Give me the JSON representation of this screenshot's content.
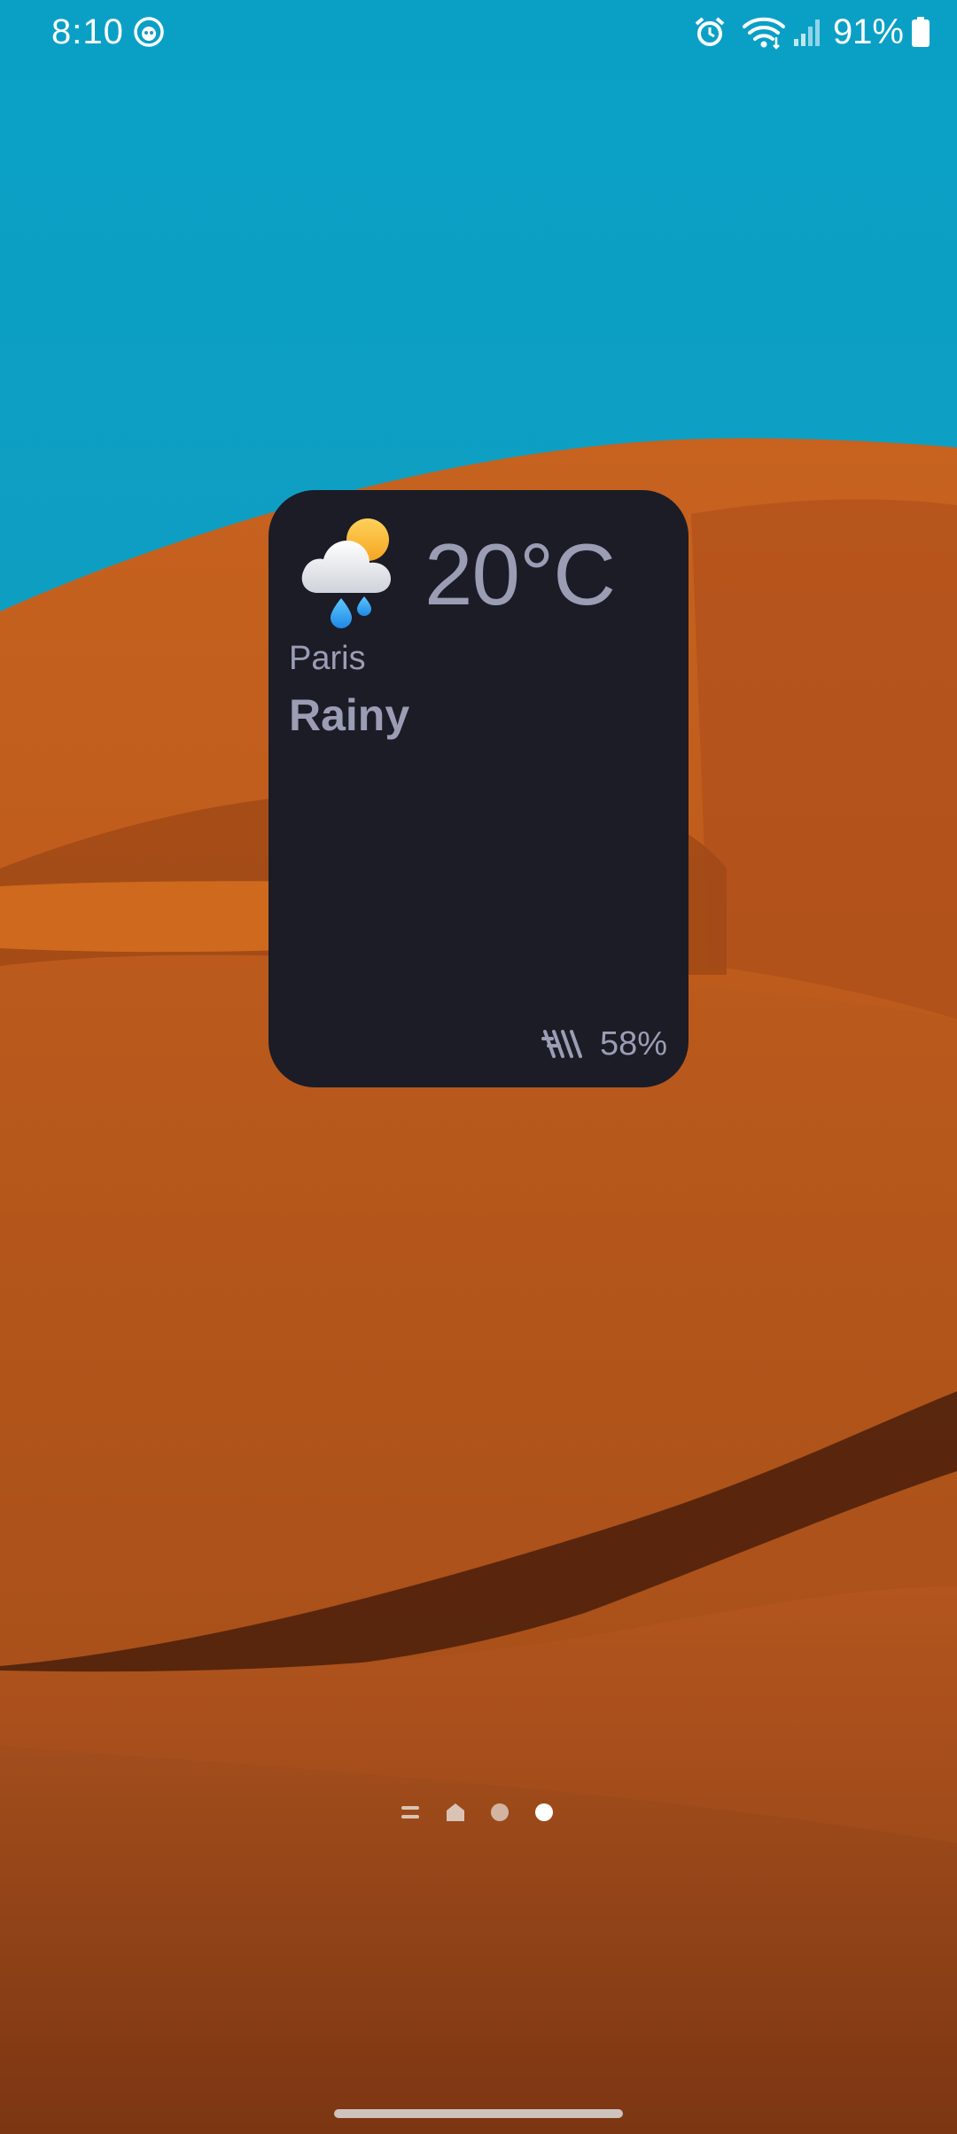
{
  "status_bar": {
    "time": "8:10",
    "battery_percent": "91%",
    "icons": [
      "notification-app-icon",
      "alarm-icon",
      "wifi-icon",
      "signal-icon",
      "battery-icon"
    ]
  },
  "weather_widget": {
    "temperature": "20°C",
    "city": "Paris",
    "condition": "Rainy",
    "humidity": "58%",
    "condition_icon": "cloud-sun-rain-icon",
    "humidity_icon": "humidity-icon"
  },
  "home_pages": {
    "indicators": [
      "menu-page-icon",
      "home-page-icon",
      "page-dot",
      "page-dot"
    ],
    "active_index": 3
  },
  "colors": {
    "sky": "#0ea0c4",
    "dune": "#b8561b",
    "widget_bg": "#1b1c26",
    "widget_text": "#9a9db3"
  }
}
